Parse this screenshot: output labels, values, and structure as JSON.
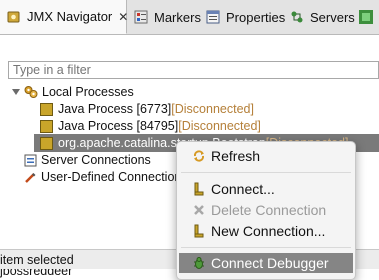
{
  "tabs": [
    {
      "label": "JMX Navigator",
      "close": "✕",
      "active": true,
      "icon": "jmx-icon"
    },
    {
      "label": "Markers",
      "icon": "markers-icon"
    },
    {
      "label": "Properties",
      "icon": "properties-icon"
    },
    {
      "label": "Servers",
      "icon": "servers-icon"
    }
  ],
  "filter": {
    "placeholder": "Type in a filter"
  },
  "tree": {
    "root": "Local Processes",
    "processes": [
      {
        "name": "Java Process [6773]",
        "status": "[Disconnected]"
      },
      {
        "name": "Java Process [84795]",
        "status": "[Disconnected]"
      },
      {
        "name": "org.apache.catalina.startup.Bootstrap",
        "status": "[Disconnected]",
        "selected": true
      }
    ],
    "server_connections": "Server Connections",
    "user_defined": "User-Defined Connections"
  },
  "context_menu": {
    "refresh": "Refresh",
    "connect": "Connect...",
    "delete": "Delete Connection",
    "new_connection": "New Connection...",
    "connect_debugger": "Connect Debugger"
  },
  "status_bar": {
    "text": "item selected"
  },
  "bottom_text": "jbossreddeer",
  "colors": {
    "accent_status": "#b5803a",
    "selection": "#7a7a7a",
    "highlight": "#858585"
  }
}
